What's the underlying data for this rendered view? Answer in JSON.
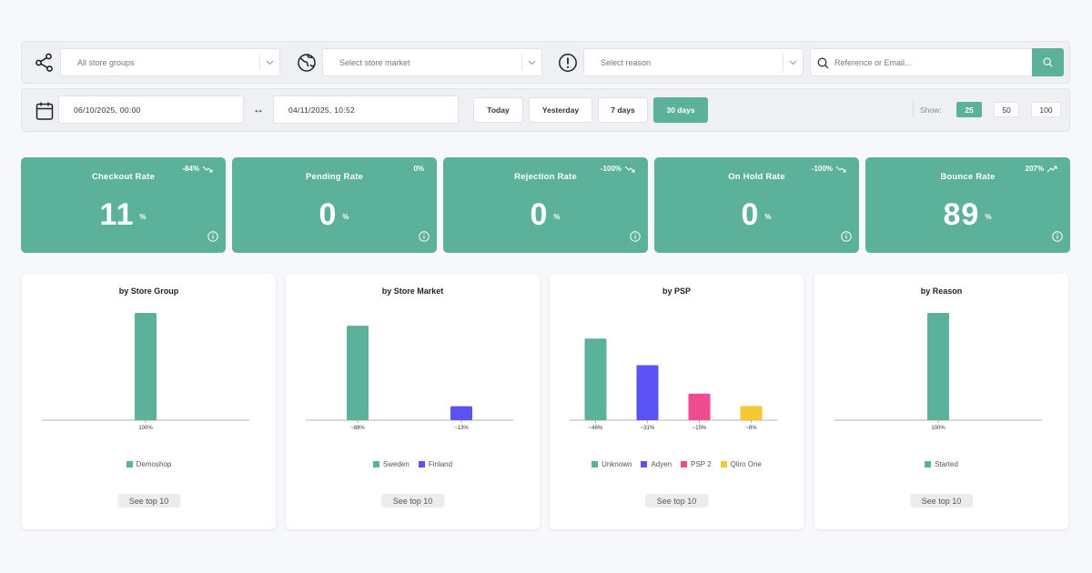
{
  "filters": {
    "store_group": {
      "value": "All store groups",
      "icon": "share-nodes-icon"
    },
    "store_market": {
      "placeholder": "Select store market",
      "icon": "globe-icon"
    },
    "reason": {
      "placeholder": "Select reason",
      "icon": "alert-circle-icon"
    },
    "search": {
      "placeholder": "Reference or Email...",
      "icon": "search-icon"
    }
  },
  "date_range": {
    "from": "06/10/2025, 00:00",
    "to": "04/11/2025, 10:52",
    "separator": "↔",
    "presets": [
      "Today",
      "Yesterday",
      "7 days",
      "30 days"
    ],
    "active_preset": "30 days"
  },
  "show": {
    "label": "Show:",
    "options": [
      "25",
      "50",
      "100"
    ],
    "active": "25"
  },
  "colors": {
    "accent": "#5cb19a",
    "blue": "#5a52f2",
    "pink": "#ef4b91",
    "yellow": "#f5c735"
  },
  "kpis": [
    {
      "title": "Checkout Rate",
      "value": "11",
      "unit": "%",
      "delta": "-84%",
      "trend": "down"
    },
    {
      "title": "Pending Rate",
      "value": "0",
      "unit": "%",
      "delta": "0%",
      "trend": "none"
    },
    {
      "title": "Rejection Rate",
      "value": "0",
      "unit": "%",
      "delta": "-100%",
      "trend": "down"
    },
    {
      "title": "On Hold Rate",
      "value": "0",
      "unit": "%",
      "delta": "-100%",
      "trend": "down"
    },
    {
      "title": "Bounce Rate",
      "value": "89",
      "unit": "%",
      "delta": "207%",
      "trend": "up"
    }
  ],
  "see_top_label": "See top 10",
  "chart_data": [
    {
      "type": "bar",
      "title": "by Store Group",
      "categories": [
        "Demoshop"
      ],
      "values": [
        100
      ],
      "labels": [
        "100%"
      ],
      "colors": [
        "#5cb19a"
      ],
      "ylim": [
        0,
        100
      ]
    },
    {
      "type": "bar",
      "title": "by Store Market",
      "categories": [
        "Sweden",
        "Finland"
      ],
      "values": [
        88,
        13
      ],
      "labels": [
        "~88%",
        "~13%"
      ],
      "colors": [
        "#5cb19a",
        "#5a52f2"
      ],
      "ylim": [
        0,
        100
      ]
    },
    {
      "type": "bar",
      "title": "by PSP",
      "categories": [
        "Unknown",
        "Adyen",
        "PSP 2",
        "Qliro One"
      ],
      "values": [
        46,
        31,
        15,
        8
      ],
      "labels": [
        "~46%",
        "~31%",
        "~15%",
        "~8%"
      ],
      "colors": [
        "#5cb19a",
        "#5a52f2",
        "#ef4b91",
        "#f5c735"
      ],
      "ylim": [
        0,
        60
      ]
    },
    {
      "type": "bar",
      "title": "by Reason",
      "categories": [
        "Started"
      ],
      "values": [
        100
      ],
      "labels": [
        "100%"
      ],
      "colors": [
        "#5cb19a"
      ],
      "ylim": [
        0,
        100
      ]
    }
  ]
}
